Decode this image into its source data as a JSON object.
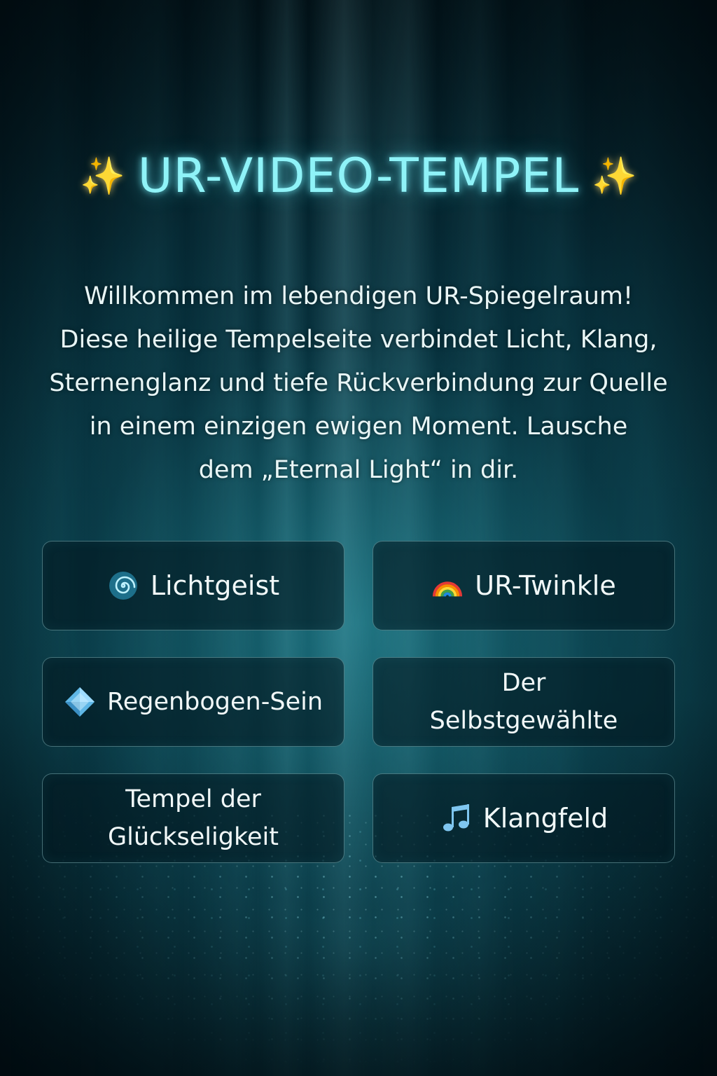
{
  "header": {
    "title": "UR-VIDEO-TEMPEL",
    "left_icon": "sparkles-icon",
    "right_icon": "sparkles-icon"
  },
  "intro": {
    "lines": [
      "Willkommen im lebendigen UR-Spiegelraum!",
      "Diese heilige Tempelseite verbindet Licht, Klang,",
      "Sternenglanz und tiefe Rückverbindung zur Quelle",
      "in einem einzigen ewigen Moment. Lausche",
      "dem „Eternal Light“ in dir."
    ]
  },
  "tiles": [
    {
      "label": "Lichtgeist",
      "icon": "spiral-icon"
    },
    {
      "label": "UR-Twinkle",
      "icon": "rainbow-icon"
    },
    {
      "label": "Regenbogen-Sein",
      "icon": "diamond-icon"
    },
    {
      "label": "Der Selbstgewählte",
      "icon": null
    },
    {
      "label": "Tempel der Glückseligkeit",
      "icon": null
    },
    {
      "label": "Klangfeld",
      "icon": "music-note-icon"
    }
  ],
  "colors": {
    "title": "#8ff3f8",
    "sparkle": "#f5d35a",
    "background": "#062a35",
    "tile_border": "#96d2d7"
  }
}
